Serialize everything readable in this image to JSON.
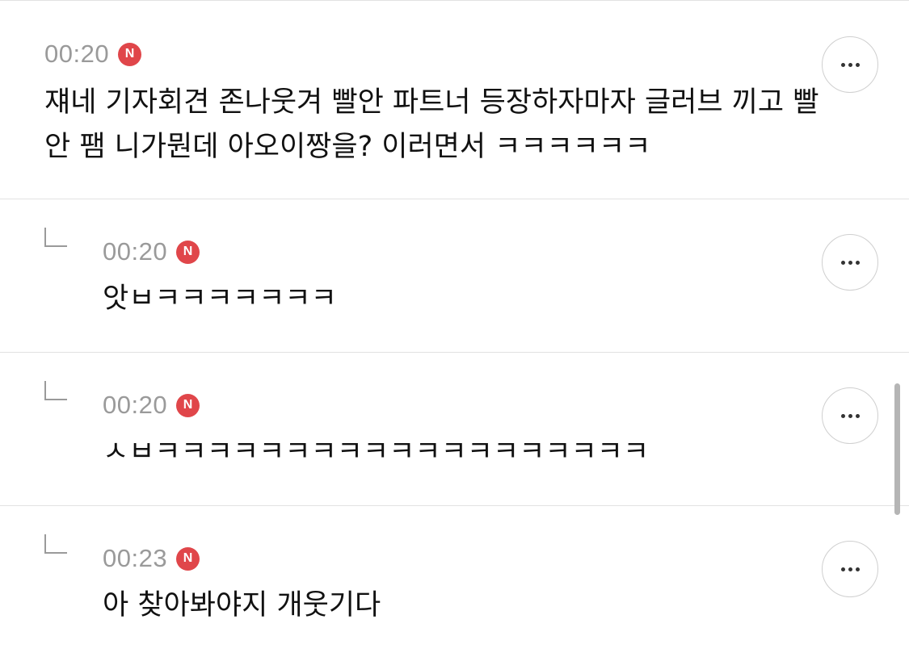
{
  "comments": [
    {
      "time": "00:20",
      "badge": "N",
      "text": "쟤네 기자회견 존나웃겨 빨안 파트너 등장하자마자 글러브 끼고 빨안 팸 니가뭔데 아오이짱을? 이러면서 ㅋㅋㅋㅋㅋㅋ",
      "is_reply": false
    },
    {
      "time": "00:20",
      "badge": "N",
      "text": "앗ㅂㅋㅋㅋㅋㅋㅋㅋ",
      "is_reply": true
    },
    {
      "time": "00:20",
      "badge": "N",
      "text": "ㅅㅂㅋㅋㅋㅋㅋㅋㅋㅋㅋㅋㅋㅋㅋㅋㅋㅋㅋㅋㅋ",
      "is_reply": true
    },
    {
      "time": "00:23",
      "badge": "N",
      "text": "아 찾아봐야지 개웃기다",
      "is_reply": true
    }
  ],
  "more_icon": "ellipsis-icon",
  "reply_icon": "reply-arrow-icon",
  "colors": {
    "badge": "#e0464a",
    "time": "#9a9a9a",
    "divider": "#e2e2e2",
    "text": "#111111"
  }
}
